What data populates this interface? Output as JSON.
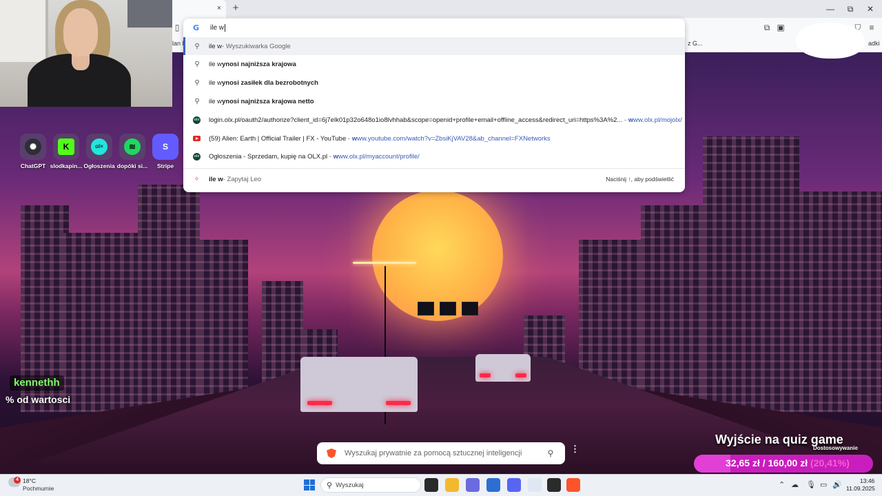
{
  "browser": {
    "new_tab_glyph": "+",
    "close_glyph": "×",
    "window": {
      "minimize": "—",
      "maximize": "⧉",
      "close": "✕"
    },
    "bookmark_fragments": {
      "left": "lan F",
      "right": "z G...",
      "far_right": "adki"
    }
  },
  "omnibox": {
    "query": "ile w",
    "suggestions": [
      {
        "type": "search",
        "icon": "search-icon",
        "plain": "ile w",
        "bold": "",
        "suffix": " - Wyszukiwarka Google",
        "selected": true
      },
      {
        "type": "search",
        "icon": "search-icon",
        "plain": "ile w",
        "bold": "ynosi najniższa krajowa",
        "suffix": ""
      },
      {
        "type": "search",
        "icon": "search-icon",
        "plain": "ile w",
        "bold": "ynosi zasiłek dla bezrobotnych",
        "suffix": ""
      },
      {
        "type": "search",
        "icon": "search-icon",
        "plain": "ile w",
        "bold": "ynosi najniższa krajowa netto",
        "suffix": ""
      },
      {
        "type": "url",
        "icon": "olx-icon",
        "title": "login.olx.pl/oauth2/authorize?client_id=6j7elk01p32o648o1io8lvhhab&scope=openid+profile+email+offline_access&redirect_uri=https%3A%2...",
        "url_bold": "w",
        "url": "ww.olx.pl/mojolx/"
      },
      {
        "type": "url",
        "icon": "youtube-icon",
        "title": "(59) Alien: Earth | Official Trailer | FX - YouTube",
        "url_bold": "w",
        "url": "ww.youtube.com/watch?v=ZbsiKjVAV28&ab_channel=FXNetworks"
      },
      {
        "type": "url",
        "icon": "olx-icon",
        "title": "Ogłoszenia - Sprzedam, kupię na OLX.pl",
        "url_bold": "w",
        "url": "ww.olx.pl/myaccount/profile/"
      }
    ],
    "leo": {
      "bold": "ile w",
      "suffix": " - Zapytaj Leo",
      "hint": "Naciśnij ↑, aby podświetlić"
    }
  },
  "desktop": {
    "shortcuts": [
      {
        "label": "ChatGPT",
        "glyph": "✺",
        "bg": "#2e2e38",
        "fg": "#ffffff"
      },
      {
        "label": "slodkapin...",
        "glyph": "K",
        "bg": "#53fc18",
        "fg": "#000000"
      },
      {
        "label": "Ogłoszenia",
        "glyph": "ol×",
        "bg": "#23e5db",
        "fg": "#002f34"
      },
      {
        "label": "dopóki si...",
        "glyph": "≋",
        "bg": "#1ed760",
        "fg": "#111111"
      },
      {
        "label": "Stripe",
        "glyph": "S",
        "bg": "#635bff",
        "fg": "#ffffff"
      }
    ]
  },
  "stream": {
    "chat_user": "kennethh",
    "chat_message": "% od wartosci",
    "quiz_title": "Wyjście na quiz game",
    "quiz_subtitle": "Dostosowywanie",
    "quiz_current": "32,65 zł",
    "quiz_separator": "/",
    "quiz_goal": "160,00 zł",
    "quiz_percent": "(20,41%)",
    "quiz_progress": 0.2041
  },
  "brave_search": {
    "placeholder": "Wyszukaj prywatnie za pomocą sztucznej inteligencji",
    "menu_glyph": "⋮"
  },
  "taskbar": {
    "weather_badge": "4",
    "temperature": "18°C",
    "condition": "Pochmurnie",
    "search_placeholder": "Wyszukaj",
    "time": "13:46",
    "date": "11.09.2025",
    "apps": [
      {
        "name": "task-view",
        "color": "#2a2a2a"
      },
      {
        "name": "file-explorer",
        "color": "#f3b92e"
      },
      {
        "name": "copilot",
        "color": "#6b6be0"
      },
      {
        "name": "microsoft-store",
        "color": "#2c6fd1"
      },
      {
        "name": "discord",
        "color": "#5865f2"
      },
      {
        "name": "notepad",
        "color": "#dfe7f3"
      },
      {
        "name": "obs",
        "color": "#2b2b2b"
      },
      {
        "name": "brave",
        "color": "#fb542b"
      }
    ]
  }
}
